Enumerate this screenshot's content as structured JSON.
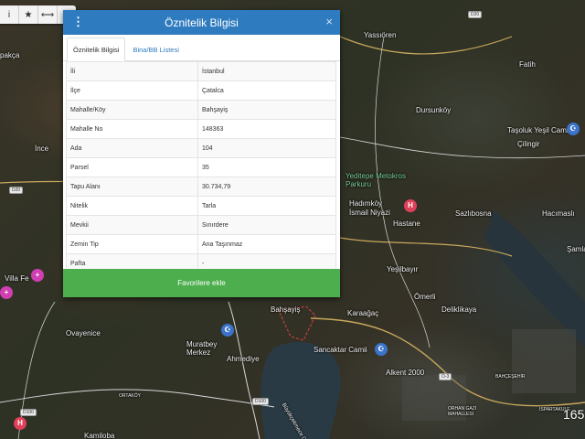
{
  "panel": {
    "title": "Öznitelik Bilgisi",
    "tabs": [
      {
        "label": "Öznitelik Bilgisi",
        "active": true
      },
      {
        "label": "Bina/BB Listesi",
        "active": false
      }
    ],
    "rows": [
      {
        "key": "İli",
        "value": "İstanbul"
      },
      {
        "key": "İlçe",
        "value": "Çatalca"
      },
      {
        "key": "Mahalle/Köy",
        "value": "Bahşayiş"
      },
      {
        "key": "Mahalle No",
        "value": "148363"
      },
      {
        "key": "Ada",
        "value": "104"
      },
      {
        "key": "Parsel",
        "value": "35"
      },
      {
        "key": "Tapu Alanı",
        "value": "30.734,79"
      },
      {
        "key": "Nitelik",
        "value": "Tarla"
      },
      {
        "key": "Mevkii",
        "value": "Sınırdere"
      },
      {
        "key": "Zemin Tip",
        "value": "Ana Taşınmaz"
      },
      {
        "key": "Pafta",
        "value": "-"
      }
    ],
    "button_label": "Favorilere ekle",
    "close_icon": "×",
    "menu_icon": "⋮"
  },
  "toolbar": {
    "info_icon": "i",
    "star_icon": "★",
    "measure_icon": "⟷",
    "expand_icon": "⬌"
  },
  "map": {
    "scale_text": "165",
    "places": {
      "yassioren": "Yassıören",
      "fatih": "Fatih",
      "pakca": "pakça",
      "dursunkoy": "Dursunköy",
      "tasoluk": "Taşoluk Yeşil Camii",
      "cilingir": "Çilingir",
      "ince": "İnce",
      "yeditepe": "Yeditepe Metokros Parkuru",
      "hadimkoy": "Hadımköy",
      "ismail": "İsmail Niyazi",
      "hastane": "Hastane",
      "sazlibosna": "Sazlıbosna",
      "hacimasli": "Hacımaslı",
      "samla": "Şamla",
      "yesilbayir": "Yeşilbayır",
      "villa": "Villa Fe",
      "omerli": "Ömerli",
      "deliklikaya": "Deliklikaya",
      "bahsayis": "Bahşayiş",
      "karaagac": "Karaağaç",
      "ovayenice": "Ovayenice",
      "muratbey": "Muratbey Merkez",
      "ahmediye": "Ahmediye",
      "sancaktar": "Sancaktar Camii",
      "alkent": "Alkent 2000",
      "bahcesehir": "BAHÇEŞEHİR",
      "ortakoy": "ORTAKÖY",
      "kamiloba": "Kamiloba",
      "buyukcekmece": "Büyükçekmece Gölü",
      "ispartakule": "İSPARTAKULE",
      "orhan": "ORHAN GAZİ MAHALLESİ"
    },
    "badges": [
      "D20",
      "D100",
      "O-3",
      "D100",
      "D20"
    ]
  }
}
